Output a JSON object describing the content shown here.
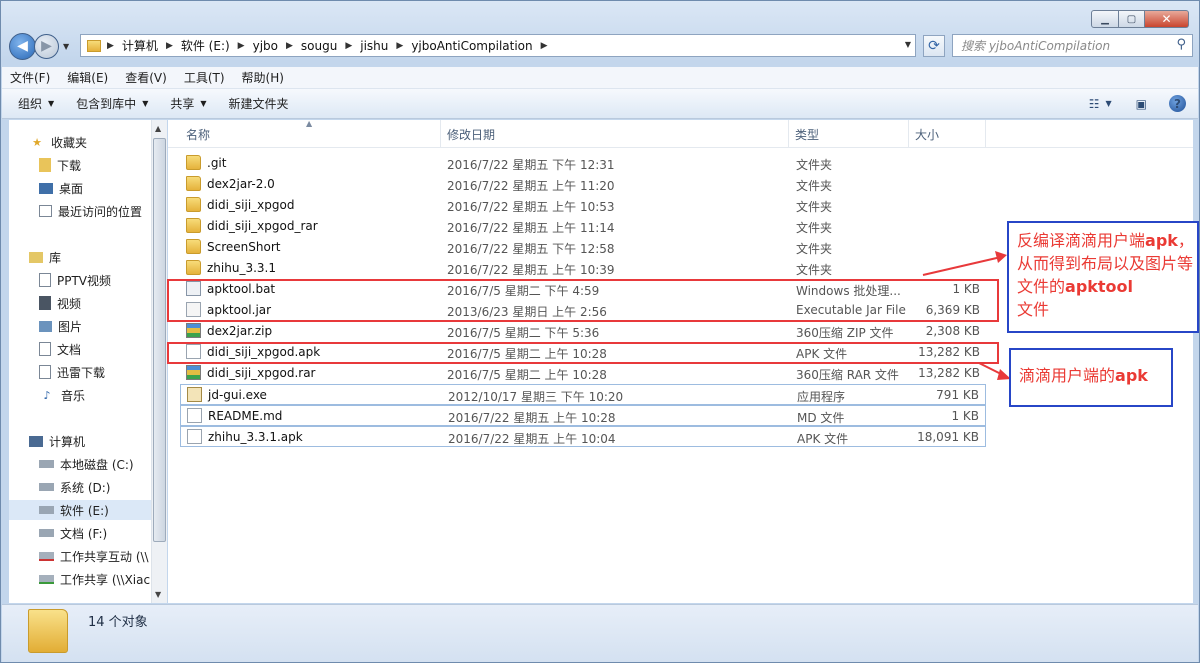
{
  "address": {
    "crumbs": [
      "计算机",
      "软件 (E:)",
      "yjbo",
      "sougu",
      "jishu",
      "yjboAntiCompilation"
    ]
  },
  "search": {
    "placeholder": "搜索 yjboAntiCompilation"
  },
  "menu": [
    "文件(F)",
    "编辑(E)",
    "查看(V)",
    "工具(T)",
    "帮助(H)"
  ],
  "commands": {
    "organize": "组织",
    "include": "包含到库中",
    "share": "共享",
    "newfolder": "新建文件夹"
  },
  "nav": {
    "favorites": "收藏夹",
    "fav_items": [
      "下载",
      "桌面",
      "最近访问的位置"
    ],
    "libraries": "库",
    "lib_items": [
      "PPTV视频",
      "视频",
      "图片",
      "文档",
      "迅雷下载",
      "音乐"
    ],
    "computer": "计算机",
    "drives": [
      "本地磁盘 (C:)",
      "系统 (D:)",
      "软件 (E:)",
      "文档 (F:)",
      "工作共享互动 (\\\\",
      "工作共享 (\\\\Xiac"
    ]
  },
  "columns": {
    "name": "名称",
    "date": "修改日期",
    "type": "类型",
    "size": "大小"
  },
  "files": [
    {
      "name": ".git",
      "date": "2016/7/22 星期五 下午 12:31",
      "type": "文件夹",
      "size": "",
      "icon": "folder"
    },
    {
      "name": "dex2jar-2.0",
      "date": "2016/7/22 星期五 上午 11:20",
      "type": "文件夹",
      "size": "",
      "icon": "folder"
    },
    {
      "name": "didi_siji_xpgod",
      "date": "2016/7/22 星期五 上午 10:53",
      "type": "文件夹",
      "size": "",
      "icon": "folder"
    },
    {
      "name": "didi_siji_xpgod_rar",
      "date": "2016/7/22 星期五 上午 11:14",
      "type": "文件夹",
      "size": "",
      "icon": "folder"
    },
    {
      "name": "ScreenShort",
      "date": "2016/7/22 星期五 下午 12:58",
      "type": "文件夹",
      "size": "",
      "icon": "folder"
    },
    {
      "name": "zhihu_3.3.1",
      "date": "2016/7/22 星期五 上午 10:39",
      "type": "文件夹",
      "size": "",
      "icon": "folder"
    },
    {
      "name": "apktool.bat",
      "date": "2016/7/5 星期二 下午 4:59",
      "type": "Windows 批处理...",
      "size": "1 KB",
      "icon": "bat"
    },
    {
      "name": "apktool.jar",
      "date": "2013/6/23 星期日 上午 2:56",
      "type": "Executable Jar File",
      "size": "6,369 KB",
      "icon": "jar"
    },
    {
      "name": "dex2jar.zip",
      "date": "2016/7/5 星期二 下午 5:36",
      "type": "360压缩 ZIP 文件",
      "size": "2,308 KB",
      "icon": "zip"
    },
    {
      "name": "didi_siji_xpgod.apk",
      "date": "2016/7/5 星期二 上午 10:28",
      "type": "APK 文件",
      "size": "13,282 KB",
      "icon": "file"
    },
    {
      "name": "didi_siji_xpgod.rar",
      "date": "2016/7/5 星期二 上午 10:28",
      "type": "360压缩 RAR 文件",
      "size": "13,282 KB",
      "icon": "zip"
    },
    {
      "name": "jd-gui.exe",
      "date": "2012/10/17 星期三 下午 10:20",
      "type": "应用程序",
      "size": "791 KB",
      "icon": "exe"
    },
    {
      "name": "README.md",
      "date": "2016/7/22 星期五 上午 10:28",
      "type": "MD 文件",
      "size": "1 KB",
      "icon": "file"
    },
    {
      "name": "zhihu_3.3.1.apk",
      "date": "2016/7/22 星期五 上午 10:04",
      "type": "APK 文件",
      "size": "18,091 KB",
      "icon": "file"
    }
  ],
  "annotations": {
    "apktool_note_a": "反编译滴滴用户端",
    "apktool_note_b": "apk",
    "apktool_note_c": "，从而得到布局以及图片等文件的",
    "apktool_note_d": "apktool",
    "apktool_note_e": "文件",
    "apk_note_a": "滴滴用户端的",
    "apk_note_b": "apk"
  },
  "status": {
    "count": "14 个对象"
  },
  "colors": {
    "annotation_red": "#e8393b",
    "annotation_blue": "#2746c7"
  }
}
